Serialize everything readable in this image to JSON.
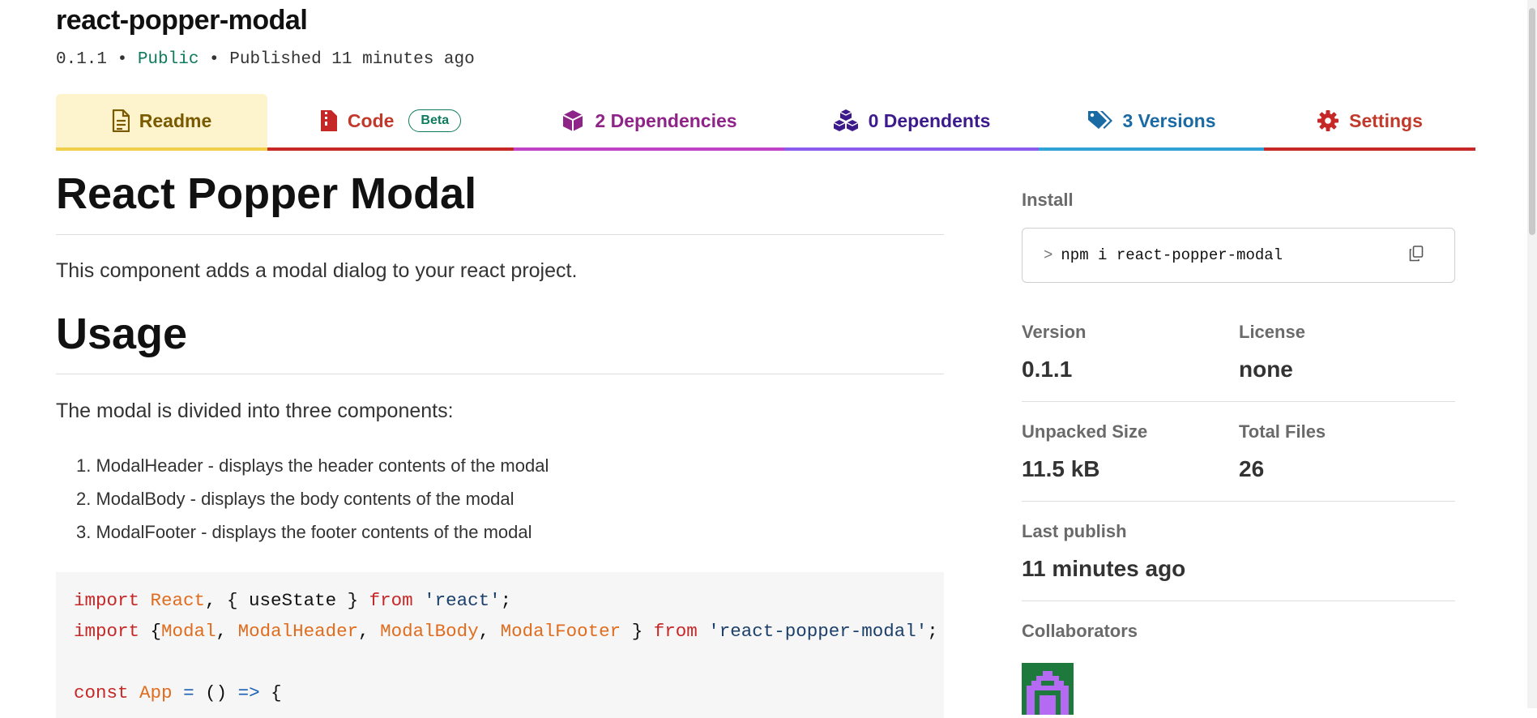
{
  "package": {
    "name": "react-popper-modal",
    "version": "0.1.1",
    "sep1": " • ",
    "visibility": "Public",
    "sep2": " • ",
    "published": "Published 11 minutes ago"
  },
  "tabs": [
    {
      "label": "Readme",
      "icon": "file-icon"
    },
    {
      "label": "Code",
      "icon": "zip-file-icon",
      "badge": "Beta"
    },
    {
      "label": "2 Dependencies",
      "icon": "box-icon"
    },
    {
      "label": "0 Dependents",
      "icon": "boxes-icon"
    },
    {
      "label": "3 Versions",
      "icon": "tags-icon"
    },
    {
      "label": "Settings",
      "icon": "gear-icon"
    }
  ],
  "readme": {
    "title": "React Popper Modal",
    "intro": "This component adds a modal dialog to your react project.",
    "usage_heading": "Usage",
    "usage_text": "The modal is divided into three components:",
    "components": [
      "1. ModalHeader - displays the header contents of the modal",
      "2. ModalBody - displays the body contents of the modal",
      "3. ModalFooter - displays the footer contents of the modal"
    ],
    "code": {
      "line1": {
        "kw1": "import",
        "cls1": "React",
        "p1": ", { useState } ",
        "kw2": "from",
        "sp": " ",
        "str": "'react'",
        "end": ";"
      },
      "line2": {
        "kw1": "import",
        "p0": " {",
        "c1": "Modal",
        "c2": "ModalHeader",
        "c3": "ModalBody",
        "c4": "ModalFooter",
        "comma": ", ",
        "p1": " } ",
        "kw2": "from",
        "sp": " ",
        "str": "'react-popper-modal'",
        "end": ";"
      },
      "line3": {
        "kw": "const",
        "cls": "App",
        "eq": "=",
        "parens": "()",
        "arrow": "=>",
        "brace": "{"
      }
    }
  },
  "sidebar": {
    "install_label": "Install",
    "install_prompt": ">",
    "install_cmd": "npm i react-popper-modal",
    "version_label": "Version",
    "version_value": "0.1.1",
    "license_label": "License",
    "license_value": "none",
    "unpacked_label": "Unpacked Size",
    "unpacked_value": "11.5 kB",
    "files_label": "Total Files",
    "files_value": "26",
    "last_publish_label": "Last publish",
    "last_publish_value": "11 minutes ago",
    "collaborators_label": "Collaborators"
  },
  "colors": {
    "public": "#0f7b5e",
    "readme_tab": "#f2cf4a",
    "code_tab": "#c62828",
    "deps_tab": "#c043c7",
    "dependents_tab": "#8a5cf0",
    "versions_tab": "#2fa3d6",
    "settings_tab": "#c62828"
  }
}
